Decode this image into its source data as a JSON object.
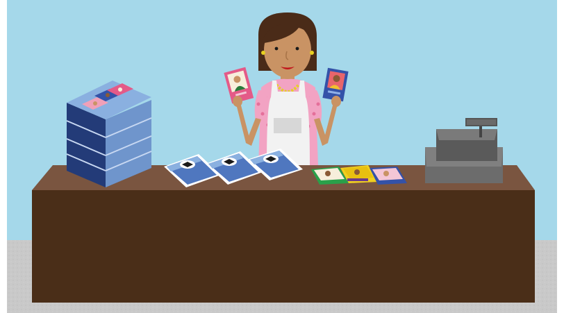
{
  "scene": {
    "description_title": "",
    "colors": {
      "wall": "#a5d8ea",
      "floor": "#c9c9c9",
      "counter_top": "#7a5540",
      "counter_front": "#4a2e18",
      "skin": "#c99364",
      "hair": "#4a2b18",
      "apron": "#f2f2f2",
      "blouse": "#f2a3c3",
      "card_box_dark": "#233b78",
      "card_box_light": "#6f95cc",
      "pack_blue": "#4f77bf",
      "register": "#6c6c6c"
    },
    "icons": [
      "shopkeeper-figure",
      "card-box-stack",
      "sticker-pack",
      "trading-card",
      "cash-register"
    ]
  }
}
